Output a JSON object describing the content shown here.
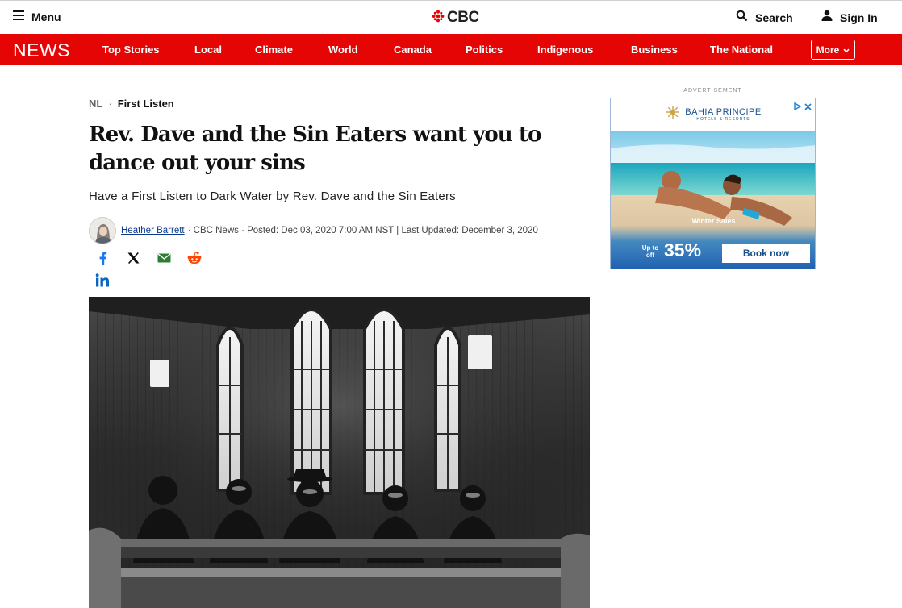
{
  "header": {
    "menu_label": "Menu",
    "logo_text": "CBC",
    "search_label": "Search",
    "signin_label": "Sign In"
  },
  "nav": {
    "brand": "NEWS",
    "items": [
      "Top Stories",
      "Local",
      "Climate",
      "World",
      "Canada",
      "Politics",
      "Indigenous",
      "Business",
      "The National"
    ],
    "more_label": "More"
  },
  "article": {
    "region": "NL",
    "category": "First Listen",
    "headline": "Rev. Dave and the Sin Eaters want you to dance out your sins",
    "subhead": "Have a First Listen to Dark Water by Rev. Dave and the Sin Eaters",
    "author": "Heather Barrett",
    "byline_meta": "· CBC News · Posted: Dec 03, 2020 7:00 AM NST | Last Updated: December 3, 2020"
  },
  "share": [
    "facebook-icon",
    "x-icon",
    "email-icon",
    "reddit-icon",
    "linkedin-icon"
  ],
  "ad": {
    "label": "ADVERTISEMENT",
    "brand": "BAHIA PRINCIPE",
    "brand_sub": "HOTELS & RESORTS",
    "headline": "Winter Sales",
    "upto": "Up to off",
    "percent": "35%",
    "cta": "Book now"
  },
  "colors": {
    "nav_red": "#e60505",
    "author_link": "#0b3a8d",
    "ad_blue": "#1a4f8c",
    "facebook": "#1877f2",
    "email": "#2e7d32",
    "reddit": "#ff4500",
    "linkedin": "#0a66c2"
  }
}
